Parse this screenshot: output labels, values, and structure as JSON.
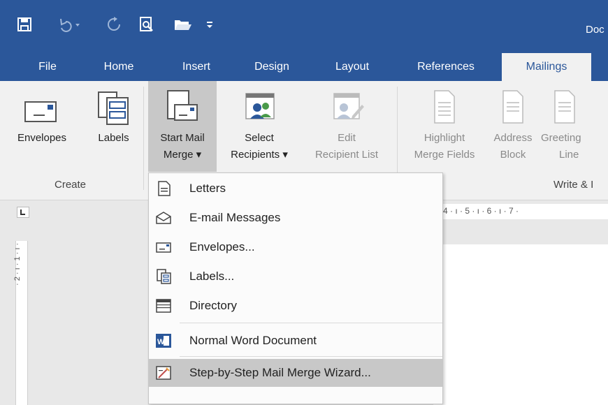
{
  "title": "Doc",
  "quick_access": [
    "save-icon",
    "undo-icon",
    "redo-icon",
    "print-preview-icon",
    "open-folder-icon",
    "customize-icon"
  ],
  "tabs": [
    "File",
    "Home",
    "Insert",
    "Design",
    "Layout",
    "References",
    "Mailings"
  ],
  "active_tab": "Mailings",
  "ribbon": {
    "create_group": "Create",
    "write_group": "Write & I",
    "envelopes": "Envelopes",
    "labels": "Labels",
    "start_mail_merge_1": "Start Mail",
    "start_mail_merge_2": "Merge ▾",
    "select_recipients_1": "Select",
    "select_recipients_2": "Recipients ▾",
    "edit_list_1": "Edit",
    "edit_list_2": "Recipient List",
    "highlight_1": "Highlight",
    "highlight_2": "Merge Fields",
    "address_1": "Address",
    "address_2": "Block",
    "greeting_1": "Greeting",
    "greeting_2": "Line"
  },
  "ruler_top": "4 · ı · 5 · ı · 6 · ı · 7 ·",
  "ruler_left": "· 2 · ı · 1 · ı ·",
  "menu": {
    "items": [
      {
        "label": "Letters",
        "icon": "letter-icon"
      },
      {
        "label": "E-mail Messages",
        "icon": "email-icon"
      },
      {
        "label": "Envelopes...",
        "icon": "envelope-icon"
      },
      {
        "label": "Labels...",
        "icon": "labels-icon"
      },
      {
        "label": "Directory",
        "icon": "directory-icon"
      },
      {
        "label": "Normal Word Document",
        "icon": "word-doc-icon"
      },
      {
        "label": "Step-by-Step Mail Merge Wizard...",
        "icon": "wizard-icon"
      }
    ]
  },
  "colors": {
    "brand": "#2b579a",
    "ribbon_bg": "#f1f1f1",
    "highlight": "#c8c8c8"
  }
}
